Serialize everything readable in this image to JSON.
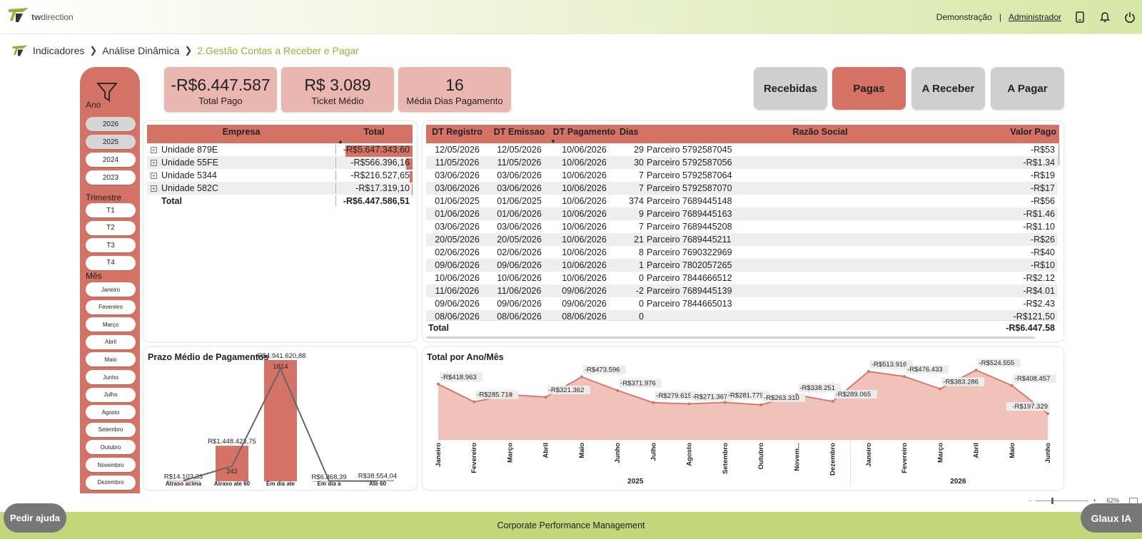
{
  "header": {
    "brand": "twdirection",
    "brand_bold": "tw",
    "brand_rest": "direction",
    "demo": "Demonstração",
    "separator": "|",
    "admin": "Administrador"
  },
  "breadcrumb": [
    "Indicadores",
    "Análise Dinâmica",
    "2.Gestão Contas a Receber e Pagar"
  ],
  "filters": {
    "ano_label": "Ano",
    "anos": [
      "2026",
      "2025",
      "2024",
      "2023"
    ],
    "anos_selected": [
      "2026",
      "2025"
    ],
    "trimestre_label": "Trimestre",
    "trimestres": [
      "T1",
      "T2",
      "T3",
      "T4"
    ],
    "mes_label": "Mês",
    "meses": [
      "Janeiro",
      "Fevereiro",
      "Março",
      "Abril",
      "Maio",
      "Junho",
      "Julho",
      "Agosto",
      "Setembro",
      "Outubro",
      "Novembro",
      "Dezembro"
    ]
  },
  "kpis": [
    {
      "value": "-R$6.447.587",
      "label": "Total Pago"
    },
    {
      "value": "R$ 3.089",
      "label": "Ticket Médio"
    },
    {
      "value": "16",
      "label": "Média Dias Pagamento"
    }
  ],
  "tabs": [
    {
      "label": "Recebidas",
      "active": false
    },
    {
      "label": "Pagas",
      "active": true
    },
    {
      "label": "A Receber",
      "active": false
    },
    {
      "label": "A Pagar",
      "active": false
    }
  ],
  "empresa_table": {
    "headers": [
      "Empresa",
      "Total"
    ],
    "rows": [
      {
        "name": "Unidade 879E",
        "total": "-R$5.647.343,60",
        "share": 0.876
      },
      {
        "name": "Unidade 55FE",
        "total": "-R$566.396,16",
        "share": 0.088
      },
      {
        "name": "Unidade 5344",
        "total": "-R$216.527,65",
        "share": 0.034
      },
      {
        "name": "Unidade 582C",
        "total": "-R$17.319,10",
        "share": 0.003
      }
    ],
    "total_label": "Total",
    "total_value": "-R$6.447.586,51"
  },
  "tx_table": {
    "headers": [
      "DT Registro",
      "DT Emissao",
      "DT Pagamento",
      "Dias",
      "Razão Social",
      "Valor Pago"
    ],
    "rows": [
      [
        "12/05/2026",
        "12/05/2026",
        "10/06/2026",
        "29",
        "Parceiro 5792587045",
        "-R$53"
      ],
      [
        "11/05/2026",
        "11/05/2026",
        "10/06/2026",
        "30",
        "Parceiro 5792587056",
        "-R$1.34"
      ],
      [
        "03/06/2026",
        "03/06/2026",
        "10/06/2026",
        "7",
        "Parceiro 5792587064",
        "-R$19"
      ],
      [
        "03/06/2026",
        "03/06/2026",
        "10/06/2026",
        "7",
        "Parceiro 5792587070",
        "-R$17"
      ],
      [
        "01/06/2025",
        "01/06/2025",
        "10/06/2026",
        "374",
        "Parceiro 7689445148",
        "-R$56"
      ],
      [
        "01/06/2026",
        "01/06/2026",
        "10/06/2026",
        "9",
        "Parceiro 7689445163",
        "-R$1.46"
      ],
      [
        "03/06/2026",
        "03/06/2026",
        "10/06/2026",
        "7",
        "Parceiro 7689445208",
        "-R$1.10"
      ],
      [
        "20/05/2026",
        "20/05/2026",
        "10/06/2026",
        "21",
        "Parceiro 7689445211",
        "-R$26"
      ],
      [
        "02/06/2026",
        "02/06/2026",
        "10/06/2026",
        "8",
        "Parceiro 7690322969",
        "-R$40"
      ],
      [
        "09/06/2026",
        "09/06/2026",
        "10/06/2026",
        "1",
        "Parceiro 7802057265",
        "-R$10"
      ],
      [
        "10/06/2026",
        "10/06/2026",
        "10/06/2026",
        "0",
        "Parceiro 7844666512",
        "-R$2.12"
      ],
      [
        "11/06/2026",
        "11/06/2026",
        "09/06/2026",
        "-2",
        "Parceiro 7689445139",
        "-R$4.01"
      ],
      [
        "09/06/2026",
        "09/06/2026",
        "09/06/2026",
        "0",
        "Parceiro 7844665013",
        "-R$2.43"
      ],
      [
        "08/06/2026",
        "08/06/2026",
        "08/06/2026",
        "0",
        "",
        "-R$121,50"
      ]
    ],
    "total_label": "Total",
    "total_value": "-R$6.447.58"
  },
  "prazo_chart": {
    "title": "Prazo Médio de Pagamentos"
  },
  "ano_mes_chart": {
    "title": "Total por Ano/Mês"
  },
  "chart_data": [
    {
      "type": "bar",
      "title": "Prazo Médio de Pagamentos",
      "categories": [
        "Atraso acima",
        "Atraso ate 60",
        "Em dia ate",
        "Em dia a",
        "Ate 60"
      ],
      "bars_labels": [
        "R$14.103,33",
        "R$1.448.423,75",
        "-R$4.941.620,88",
        "R$6.868,39",
        "R$38.554,04"
      ],
      "bar_values": [
        14103.33,
        1448423.75,
        4941620.88,
        6868.39,
        38554.04
      ],
      "line_values": [
        10,
        242,
        1814,
        6,
        2
      ],
      "line_labels": [
        "",
        "242",
        "1814",
        "",
        ""
      ]
    },
    {
      "type": "area",
      "title": "Total por Ano/Mês",
      "categories": [
        "Janeiro",
        "Fevereiro",
        "Março",
        "Abril",
        "Maio",
        "Junho",
        "Julho",
        "Agosto",
        "Setembro",
        "Outubro",
        "Novem...",
        "Dezembro",
        "Janeiro",
        "Fevereiro",
        "Março",
        "Abril",
        "Maio",
        "Junho"
      ],
      "groups": [
        {
          "label": "2025",
          "count": 12
        },
        {
          "label": "2026",
          "count": 6
        }
      ],
      "values": [
        418963,
        285710,
        340000,
        321362,
        473596,
        371976,
        279615,
        271367,
        281779,
        263310,
        338251,
        289065,
        513916,
        476433,
        383286,
        524555,
        408457,
        197329
      ],
      "labels": [
        "-R$418.963",
        "-R$285.710",
        "",
        "-R$321.362",
        "-R$473.596",
        "-R$371.976",
        "-R$279.615",
        "-R$271.367",
        "-R$281.779",
        "-R$263.310",
        "-R$338.251",
        "-R$289.065",
        "-R$513.916",
        "-R$476.433",
        "-R$383.286",
        "-R$524.555",
        "-R$408.457",
        "-R$197.329"
      ]
    }
  ],
  "footer": {
    "text": "Corporate Performance Management",
    "help": "Pedir ajuda",
    "glaux": "Glaux IA",
    "zoom": "62%",
    "zoom_minus": "-",
    "zoom_plus": "+"
  },
  "colors": {
    "accent": "#d47365",
    "light_accent": "#e9b6b0",
    "area": "#f0c2ba",
    "brand_green": "#94b23a",
    "footer": "#c2d67a"
  }
}
